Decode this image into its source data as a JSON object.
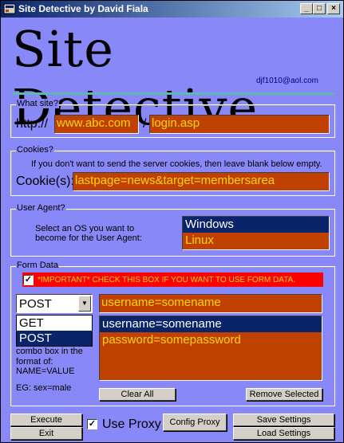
{
  "window": {
    "title": "Site Detective by David Fiala"
  },
  "header": {
    "logo_text": "Site Detective",
    "email": "djf1010@aol.com"
  },
  "what_site": {
    "legend": "What site?",
    "prefix": "http://",
    "host": "www.abc.com",
    "separator": "/",
    "path": "login.asp"
  },
  "cookies": {
    "legend": "Cookies?",
    "hint": "If you don't want to send the server cookies, then leave blank below empty.",
    "label": "Cookie(s):",
    "value": "lastpage=news&target=membersarea"
  },
  "user_agent": {
    "legend": "User Agent?",
    "hint_line1": "Select an OS you want to",
    "hint_line2": "become for the User Agent:",
    "options": [
      "Windows",
      "Linux"
    ],
    "selected_index": 0
  },
  "form_data": {
    "legend": "Form Data",
    "important_text": "*IMPORTANT* CHECK THIS BOX IF YOU WANT TO USE FORM DATA.",
    "important_checked": true,
    "method": "POST",
    "method_options": [
      "GET",
      "POST"
    ],
    "help_lines": [
      "combo box in the",
      "format of:",
      "NAME=VALUE"
    ],
    "example": "EG: sex=male",
    "input_value": "username=somename",
    "entries": [
      "username=somename",
      "password=somepassword"
    ],
    "selected_entry": 0,
    "clear_all_label": "Clear All",
    "remove_selected_label": "Remove Selected"
  },
  "bottom": {
    "execute_label": "Execute",
    "exit_label": "Exit",
    "use_proxy_label": "Use Proxy",
    "use_proxy_checked": true,
    "config_proxy_label": "Config Proxy",
    "save_settings_label": "Save Settings",
    "load_settings_label": "Load Settings"
  },
  "colors": {
    "background": "#8888f8",
    "field_bg": "#c04000",
    "field_text": "#ffd700",
    "selection": "#0a246a",
    "important": "#ff0000"
  }
}
